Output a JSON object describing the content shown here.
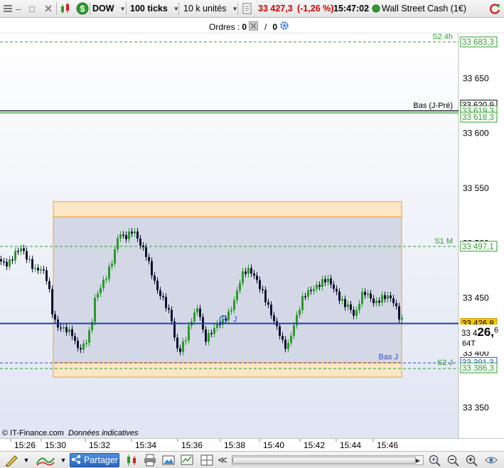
{
  "toolbar": {
    "minimize_glyph": "–",
    "restore_glyph": "□",
    "instrument": "DOW",
    "interval": "100 ticks",
    "quantity": "10 k unités",
    "price": "33 427,3",
    "change": "(-1,26 %)",
    "time": "15:47:02",
    "instrument_name": "Wall Street Cash (1€)",
    "colors": {
      "negative": "#cc0000",
      "market_open": "#2e9e2e"
    }
  },
  "orders": {
    "label": "Ordres :",
    "count_a": "0",
    "slash": "/",
    "count_b": "0"
  },
  "chart": {
    "price_labels": [
      {
        "value": 33683.3,
        "text": "33 683,3",
        "kind": "green"
      },
      {
        "value": 33650,
        "text": "33 650",
        "kind": "tick"
      },
      {
        "value": 33620.9,
        "text": "33 620,9",
        "kind": "black"
      },
      {
        "value": 33619.3,
        "text": "33 619,3",
        "kind": "green"
      },
      {
        "value": 33618.3,
        "text": "33 618,3",
        "kind": "green"
      },
      {
        "value": 33600,
        "text": "33 600",
        "kind": "tick"
      },
      {
        "value": 33550,
        "text": "33 550",
        "kind": "tick"
      },
      {
        "value": 33500,
        "text": "33 500",
        "kind": "tick"
      },
      {
        "value": 33497.1,
        "text": "33 497,1",
        "kind": "green"
      },
      {
        "value": 33450,
        "text": "33 450",
        "kind": "tick"
      },
      {
        "value": 33426.8,
        "text": "33 426,8",
        "kind": "current"
      },
      {
        "value": 33400,
        "text": "33 400",
        "kind": "tick"
      },
      {
        "value": 33391.3,
        "text": "33 391,3",
        "kind": "blue"
      },
      {
        "value": 33386.3,
        "text": "33 386,3",
        "kind": "green"
      },
      {
        "value": 33350,
        "text": "33 350",
        "kind": "tick"
      }
    ],
    "big_price": {
      "prefix": "33 4",
      "big": "26,",
      "small": "6"
    },
    "tick_count": "64T",
    "level_labels": [
      {
        "text": "S2 4h",
        "value": 33683.3
      },
      {
        "text": "Bas (J-Pré)",
        "value": 33620.9
      },
      {
        "text": "S1 M",
        "value": 33497.1
      },
      {
        "text": "S2 J",
        "value": 33386.3
      },
      {
        "text": "Bas J",
        "value": 33391.3
      }
    ],
    "bubble_label": "J",
    "watermark": "© IT-Finance.com",
    "watermark_note": "Données indicatives"
  },
  "x_axis": {
    "labels": [
      "15:26",
      "15:30",
      "15:32",
      "15:34",
      "15:36",
      "15:38",
      "15:40",
      "15:42",
      "15:44",
      "15:46"
    ]
  },
  "bottom": {
    "share_label": "Partager",
    "scroll_left_glyph": "≪",
    "scroll_right_glyph": "▶"
  }
}
